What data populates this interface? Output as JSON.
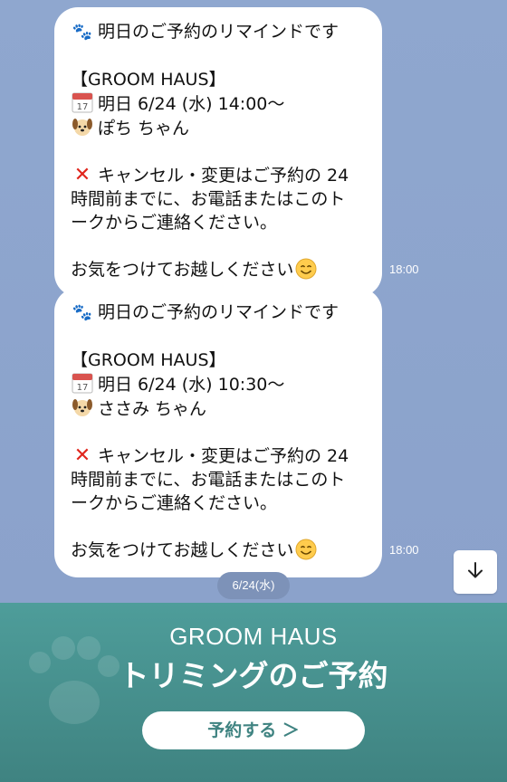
{
  "messages": [
    {
      "title": "明日のご予約のリマインドです",
      "shop": "【GROOM HAUS】",
      "date_line": "明日 6/24 (水) 14:00～",
      "pet_line": "ぽち ちゃん",
      "cancel_line1": "キャンセル・変更はご予約の 24",
      "cancel_line2": "時間前までに、お電話またはこのト",
      "cancel_line3": "ークからご連絡ください。",
      "closing": "お気をつけてお越しください",
      "time": "18:00"
    },
    {
      "title": "明日のご予約のリマインドです",
      "shop": "【GROOM HAUS】",
      "date_line": "明日 6/24 (水) 10:30～",
      "pet_line": "ささみ ちゃん",
      "cancel_line1": "キャンセル・変更はご予約の 24",
      "cancel_line2": "時間前までに、お電話またはこのト",
      "cancel_line3": "ークからご連絡ください。",
      "closing": "お気をつけてお越しください",
      "time": "18:00"
    }
  ],
  "date_separator": "6/24(水)",
  "calendar_day": "17",
  "icons": {
    "title": "paw-prints-icon",
    "date": "calendar-icon",
    "pet": "dog-face-icon",
    "cancel": "cross-mark-icon",
    "closing": "smiling-face-icon",
    "scroll": "arrow-down-icon"
  },
  "banner": {
    "title": "GROOM HAUS",
    "subtitle": "トリミングのご予約",
    "button": "予約する ＞"
  },
  "colors": {
    "chat_background": "#8ea4cc",
    "banner_background": "#4e9d9a",
    "button_text": "#3f8381",
    "cancel_mark": "#e0261d"
  }
}
